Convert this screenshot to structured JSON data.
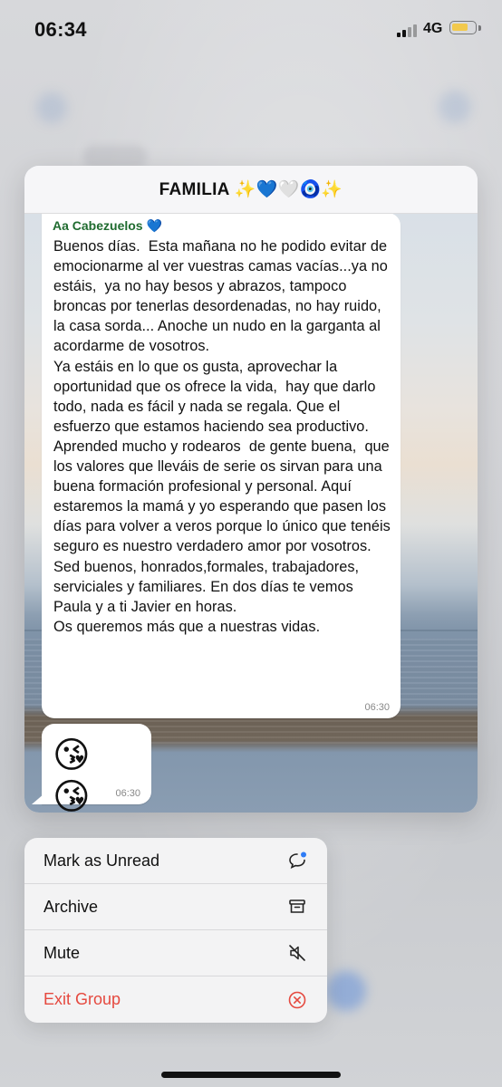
{
  "status_bar": {
    "time": "06:34",
    "network": "4G",
    "battery_color": "#f2c94c"
  },
  "chat": {
    "title": "FAMILIA ✨💙🤍🧿✨",
    "messages": [
      {
        "sender": "Aa Cabezuelos 💙",
        "text": "Buenos días.  Esta mañana no he podido evitar de emocionarme al ver vuestras camas vacías...ya no estáis,  ya no hay besos y abrazos, tampoco broncas por tenerlas desordenadas, no hay ruido, la casa sorda... Anoche un nudo en la garganta al acordarme de vosotros.\nYa estáis en lo que os gusta, aprovechar la oportunidad que os ofrece la vida,  hay que darlo todo, nada es fácil y nada se regala. Que el esfuerzo que estamos haciendo sea productivo. Aprended mucho y rodearos  de gente buena,  que los valores que lleváis de serie os sirvan para una buena formación profesional y personal. Aquí estaremos la mamá y yo esperando que pasen los días para volver a veros porque lo único que tenéis seguro es nuestro verdadero amor por vosotros.\nSed buenos, honrados,formales, trabajadores, serviciales y familiares. En dos días te vemos Paula y a ti Javier en horas.\nOs queremos más que a nuestras vidas.",
        "time": "06:30"
      },
      {
        "emoji": "😘 😘",
        "time": "06:30"
      }
    ],
    "sender_color": "#1f6b2f"
  },
  "menu": {
    "items": [
      {
        "label": "Mark as Unread",
        "icon": "chat-bubble-unread-icon"
      },
      {
        "label": "Archive",
        "icon": "archive-box-icon"
      },
      {
        "label": "Mute",
        "icon": "speaker-muted-icon"
      },
      {
        "label": "Exit Group",
        "icon": "exit-circle-x-icon",
        "color": "#e5493f"
      }
    ]
  }
}
